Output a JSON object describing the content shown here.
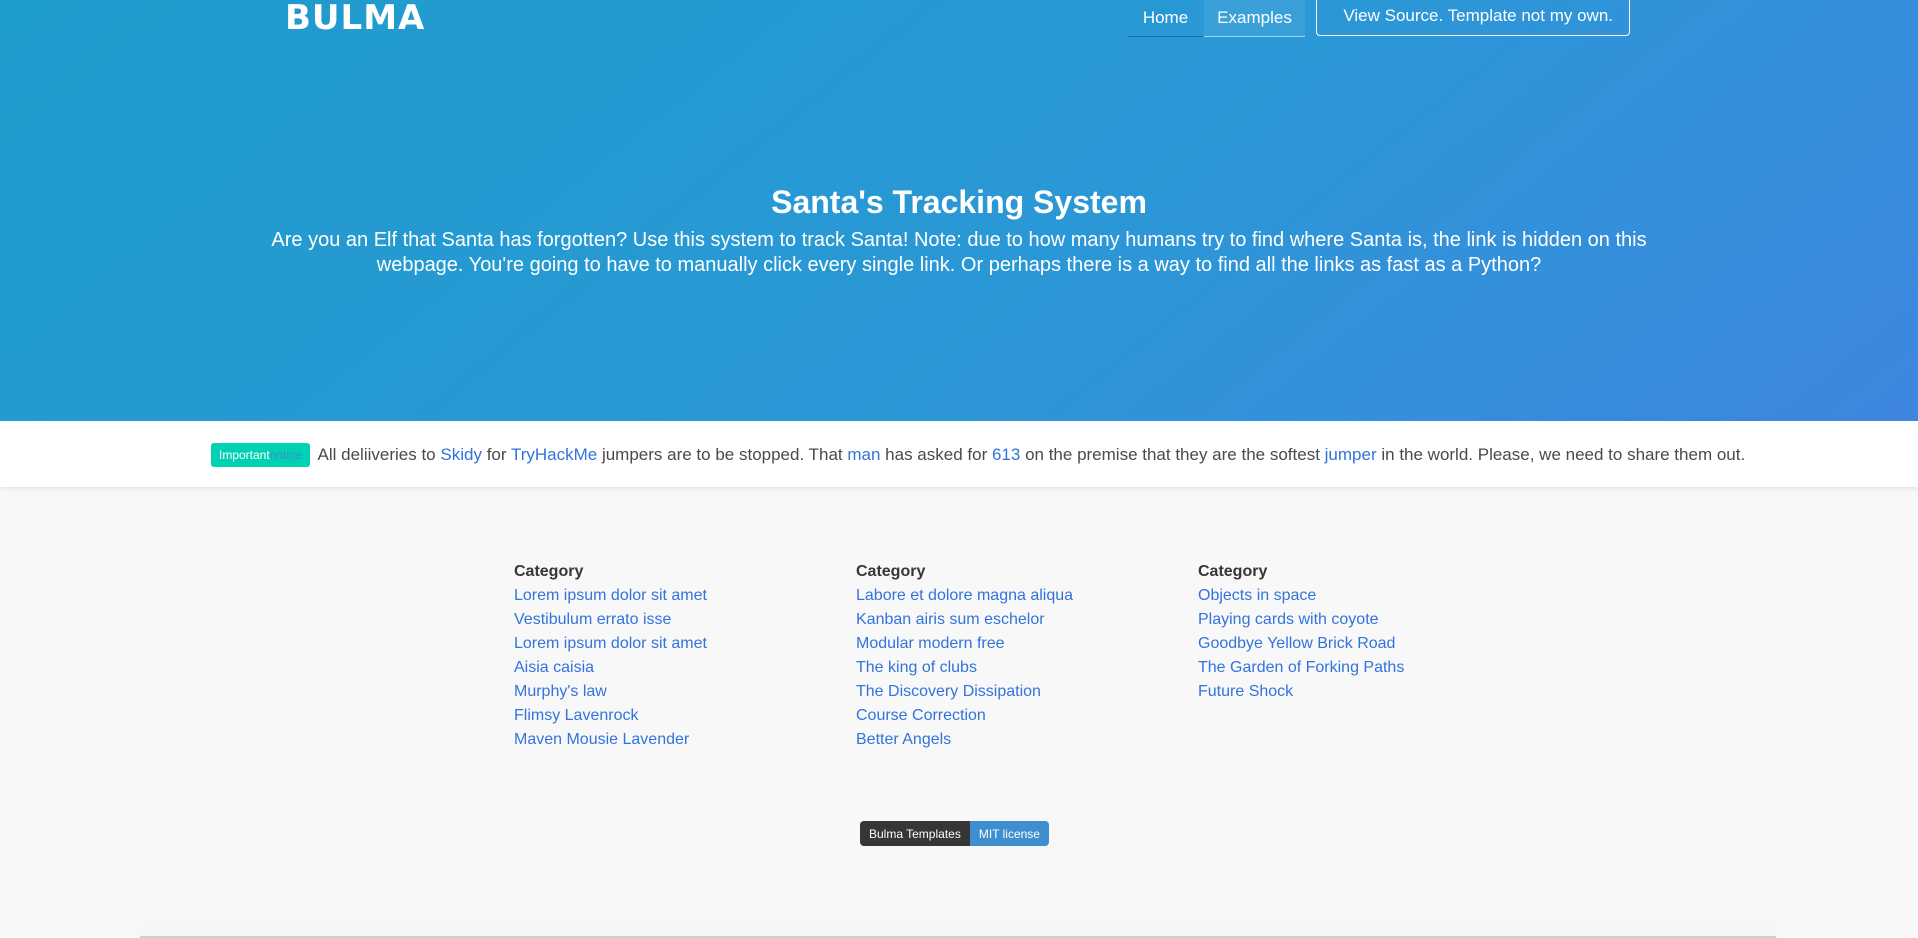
{
  "brand": "BULMA",
  "nav": {
    "home": "Home",
    "examples": "Examples",
    "source": "View Source. Template not my own."
  },
  "hero": {
    "title": "Santa's Tracking System",
    "subtitle": "Are you an Elf that Santa has forgotten? Use this system to track Santa! Note: due to how many humans try to find where Santa is, the link is hidden on this webpage. You're going to have to manually click every single link. Or perhaps there is a way to find all the links as fast as a Python?"
  },
  "notice": {
    "tag_word1": "Important",
    "tag_word2": "notice",
    "t1": "All deliiveries to",
    "l1": "Skidy",
    "t2": "for",
    "l2": "TryHackMe",
    "t3": "jumpers are to be stopped. That",
    "l3": "man",
    "t4": "has asked for",
    "l4": "613",
    "t5": "on the premise that they are the softest",
    "l5": "jumper",
    "t6": "in the world. Please, we need to share them out."
  },
  "columns": [
    {
      "heading": "Category",
      "links": [
        "Lorem ipsum dolor sit amet",
        "Vestibulum errato isse",
        "Lorem ipsum dolor sit amet",
        "Aisia caisia",
        "Murphy's law",
        "Flimsy Lavenrock",
        "Maven Mousie Lavender"
      ]
    },
    {
      "heading": "Category",
      "links": [
        "Labore et dolore magna aliqua",
        "Kanban airis sum eschelor",
        "Modular modern free",
        "The king of clubs",
        "The Discovery Dissipation",
        "Course Correction",
        "Better Angels"
      ]
    },
    {
      "heading": "Category",
      "links": [
        "Objects in space",
        "Playing cards with coyote",
        "Goodbye Yellow Brick Road",
        "The Garden of Forking Paths",
        "Future Shock"
      ]
    }
  ],
  "badge": {
    "left": "Bulma Templates",
    "right": "MIT license"
  },
  "colors": {
    "hero_start": "#1e9ccc",
    "hero_end": "#3f86e0",
    "link": "#3273dc",
    "notice_tag": "#00d1b2",
    "badge_dark": "#363636",
    "badge_blue": "#3e8ed0"
  }
}
